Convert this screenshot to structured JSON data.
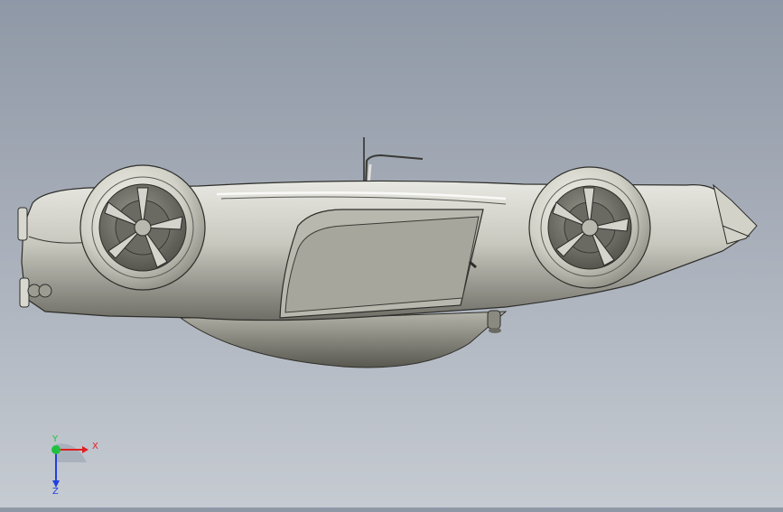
{
  "viewport": {
    "model": "car-body-upside-down",
    "background_top": "#8f98a6",
    "background_bottom": "#c6cbd2",
    "body_color": "#c9c9c1"
  },
  "triad": {
    "x_label": "X",
    "y_label": "Y",
    "z_label": "Z",
    "x_color": "#e02020",
    "y_color": "#20c040",
    "z_color": "#2040e0"
  }
}
